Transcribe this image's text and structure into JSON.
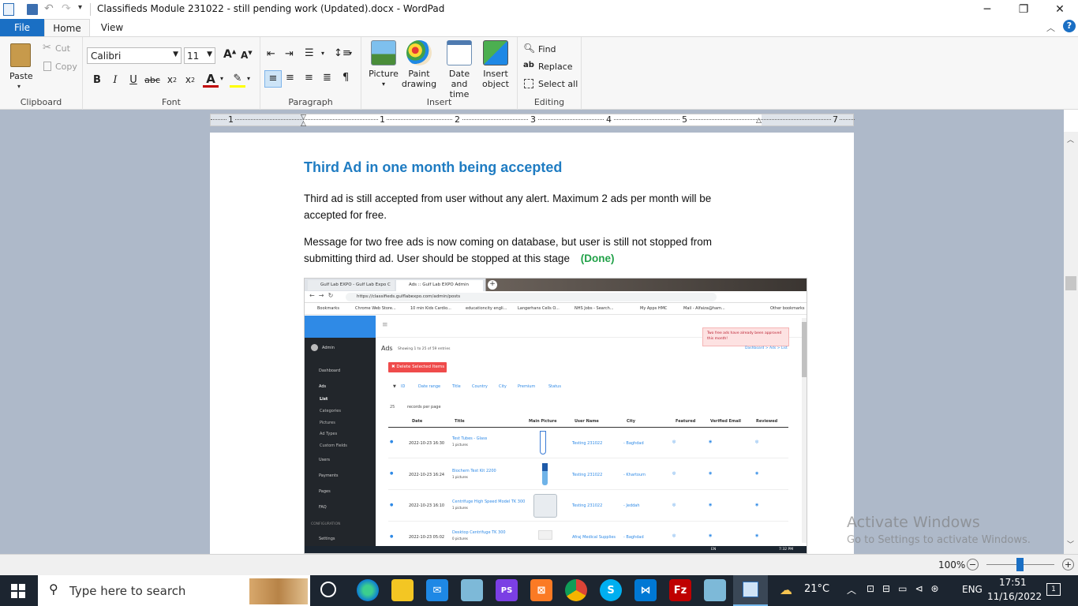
{
  "window": {
    "title": "Classifieds Module 231022 - still pending work (Updated).docx - WordPad",
    "minimize": "─",
    "restore": "❐",
    "close": "✕"
  },
  "tabs": {
    "file": "File",
    "home": "Home",
    "view": "View"
  },
  "ribbon": {
    "clipboard": {
      "label": "Clipboard",
      "paste": "Paste",
      "cut": "Cut",
      "copy": "Copy"
    },
    "font": {
      "label": "Font",
      "family": "Calibri",
      "size": "11"
    },
    "paragraph": {
      "label": "Paragraph"
    },
    "insert": {
      "label": "Insert",
      "picture": "Picture",
      "paint_drawing_1": "Paint",
      "paint_drawing_2": "drawing",
      "date_time_1": "Date and",
      "date_time_2": "time",
      "insert_object_1": "Insert",
      "insert_object_2": "object"
    },
    "editing": {
      "label": "Editing",
      "find": "Find",
      "replace": "Replace",
      "select_all": "Select all"
    }
  },
  "ruler": {
    "marks": [
      "1",
      "1",
      "2",
      "3",
      "4",
      "5",
      "7"
    ]
  },
  "document": {
    "heading": "Third Ad in one month being accepted",
    "para1": "Third ad is still accepted from user without any alert. Maximum 2 ads per month will be accepted for free.",
    "para2": "Message for two free ads is now coming on database, but user is still not stopped from submitting third ad. User should be stopped at this stage",
    "done": "(Done)"
  },
  "embedded": {
    "tab1": "Gulf Lab EXPO - Gulf Lab Expo C",
    "tab2": "Ads :: Gulf Lab EXPO Admin",
    "url": "https://classifieds.gulflabexpo.com/admin/posts",
    "bookmarks": [
      "Bookmarks",
      "Chrome Web Store...",
      "10 min Kids Cardio...",
      "educationcity engli...",
      "Langerhans Cells O...",
      "NHS Jobs - Search...",
      "My Apps HMC",
      "Mail - Alfaiza@ham...",
      "Other bookmarks"
    ],
    "sidebar": [
      "Admin",
      "Dashboard",
      "Ads",
      "List",
      "Categories",
      "Pictures",
      "Ad Types",
      "Custom Fields",
      "Users",
      "Payments",
      "Pages",
      "FAQ",
      "CONFIGURATION",
      "Settings"
    ],
    "alert": "Two free ads have already been approved this month!",
    "breadcrumb": "Dashboard > Ads > List",
    "title": "Ads",
    "subtitle": "Showing 1 to 25 of 59 entries",
    "delete_btn": "✖ Delete Selected Items",
    "filters": [
      "ID",
      "Date range",
      "Title",
      "Country",
      "City",
      "Premium",
      "Status"
    ],
    "per_page": "25",
    "per_page_label": "records per page",
    "columns": [
      "Date",
      "Title",
      "Main Picture",
      "User Name",
      "City",
      "Featured",
      "Verified Email",
      "Reviewed"
    ],
    "rows": [
      {
        "date": "2022-10-23 16:30",
        "title": "Test Tubes - Glass",
        "pics": "1 pictures",
        "user": "Testing 231022",
        "city": "- Baghdad"
      },
      {
        "date": "2022-10-23 16:24",
        "title": "Biochem Test Kit 2200",
        "pics": "1 pictures",
        "user": "Testing 231022",
        "city": "- Khartoum"
      },
      {
        "date": "2022-10-23 16:10",
        "title": "Centrifuge High Speed Model TK 300",
        "pics": "1 pictures",
        "user": "Testing 231022",
        "city": "- Jeddah"
      },
      {
        "date": "2022-10-23 05:02",
        "title": "Desktop Centrifuge TK 300",
        "pics": "0 pictures",
        "user": "Afraj Medical Supplies",
        "city": "- Baghdad"
      }
    ],
    "tray_time": "7:32 PM",
    "tray_lang": "EN"
  },
  "statusbar": {
    "zoom": "100%"
  },
  "watermark": {
    "line1": "Activate Windows",
    "line2": "Go to Settings to activate Windows."
  },
  "taskbar": {
    "search": "Type here to search",
    "weather": "21°C",
    "lang": "ENG",
    "time": "17:51",
    "date": "11/16/2022",
    "notif": "1"
  },
  "colors": {
    "accent": "#1a6fc4",
    "heading": "#1f7cc2",
    "done": "#21a148",
    "taskbar": "#1c2530",
    "file_tab": "#1a6fc4"
  }
}
